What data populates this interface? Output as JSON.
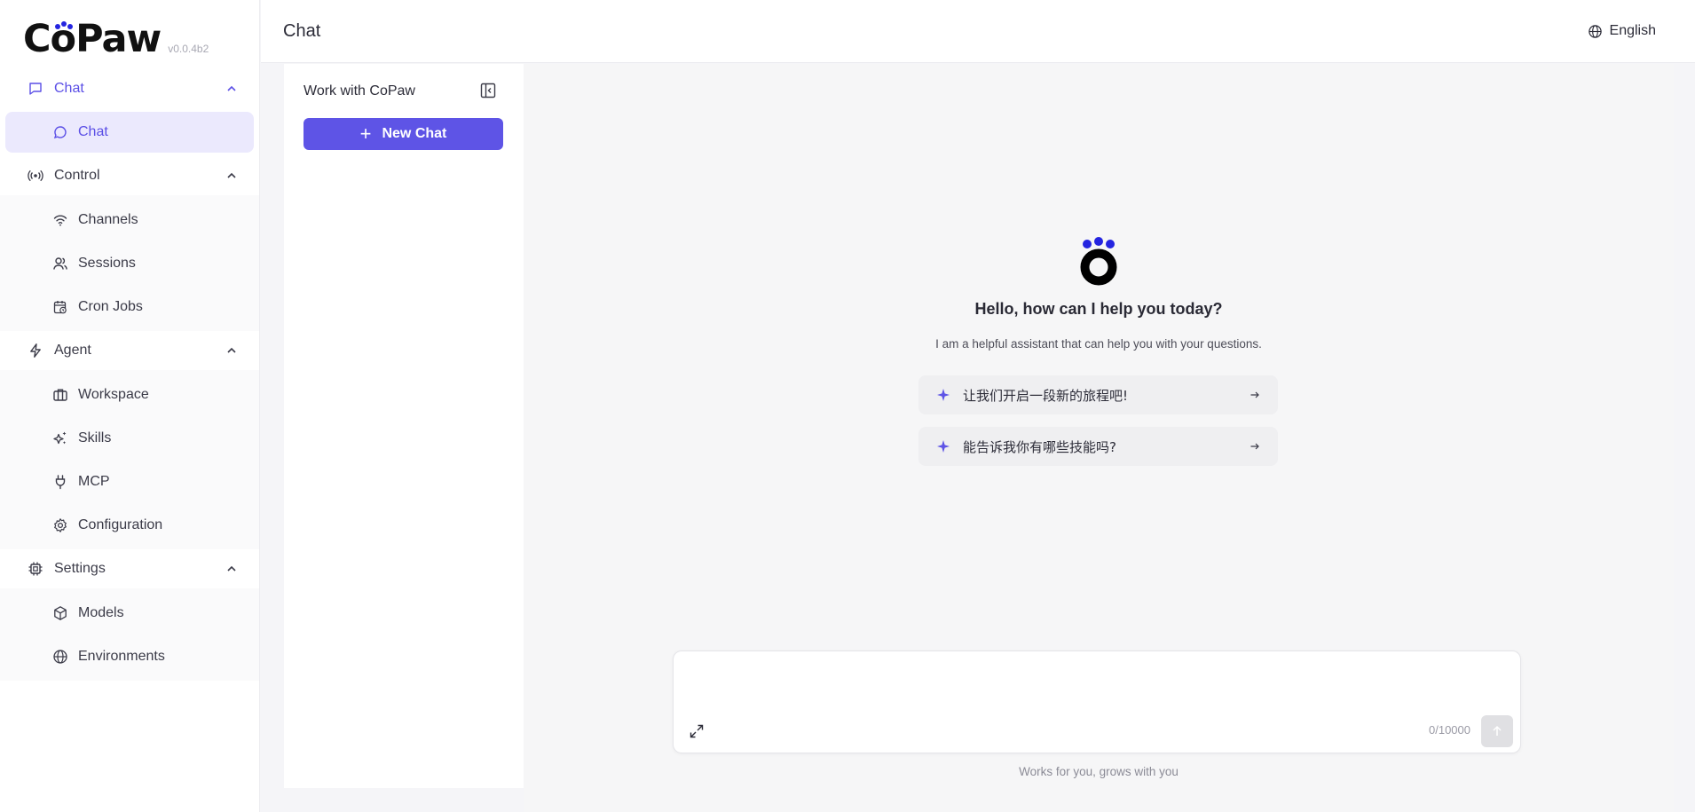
{
  "app": {
    "logo_text": "CoPaw",
    "version": "v0.0.4b2"
  },
  "sidebar": {
    "groups": [
      {
        "label": "Chat",
        "icon": "chat-bubble-icon",
        "items": [
          {
            "label": "Chat",
            "icon": "chat-bubble-icon",
            "selected": true
          }
        ]
      },
      {
        "label": "Control",
        "icon": "broadcast-icon",
        "items": [
          {
            "label": "Channels",
            "icon": "wifi-icon"
          },
          {
            "label": "Sessions",
            "icon": "users-icon"
          },
          {
            "label": "Cron Jobs",
            "icon": "calendar-clock-icon"
          }
        ]
      },
      {
        "label": "Agent",
        "icon": "lightning-icon",
        "items": [
          {
            "label": "Workspace",
            "icon": "briefcase-icon"
          },
          {
            "label": "Skills",
            "icon": "sparkles-icon"
          },
          {
            "label": "MCP",
            "icon": "plug-icon"
          },
          {
            "label": "Configuration",
            "icon": "gear-icon"
          }
        ]
      },
      {
        "label": "Settings",
        "icon": "chip-icon",
        "items": [
          {
            "label": "Models",
            "icon": "cube-icon"
          },
          {
            "label": "Environments",
            "icon": "globe-icon"
          }
        ]
      }
    ]
  },
  "header": {
    "title": "Chat",
    "language": "English"
  },
  "chat_list": {
    "title": "Work with CoPaw",
    "new_chat_label": "New Chat"
  },
  "welcome": {
    "title": "Hello, how can I help you today?",
    "subtitle": "I am a helpful assistant that can help you with your questions.",
    "prompts": [
      "让我们开启一段新的旅程吧!",
      "能告诉我你有哪些技能吗?"
    ]
  },
  "composer": {
    "value": "",
    "placeholder": "",
    "counter": "0/10000"
  },
  "footer": {
    "note": "Works for you, grows with you"
  },
  "colors": {
    "accent": "#5e54e6",
    "selected_bg": "#ebe9fd",
    "logo_dots": "#2424e0"
  }
}
